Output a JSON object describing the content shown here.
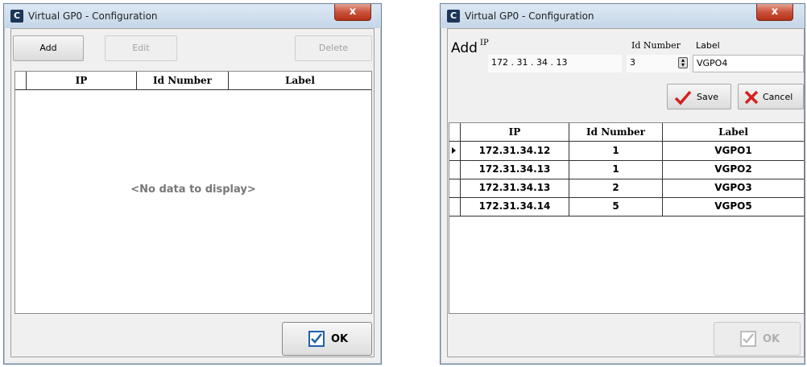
{
  "left_window": {
    "title": "Virtual GP0 - Configuration",
    "close_glyph": "x",
    "app_icon": "C",
    "toolbar": {
      "add": "Add",
      "edit": "Edit",
      "delete": "Delete"
    },
    "grid": {
      "columns": [
        "IP",
        "Id Number",
        "Label"
      ],
      "empty_text": "<No data to display>"
    },
    "ok_label": "OK"
  },
  "right_window": {
    "title": "Virtual GP0 - Configuration",
    "close_glyph": "x",
    "app_icon": "C",
    "form": {
      "heading": "Add",
      "ip_label": "IP",
      "ip_value": "172  .  31  .  34  .  13",
      "id_label": "Id Number",
      "id_value": "3",
      "label_label": "Label",
      "label_value": "VGPO4",
      "save": "Save",
      "cancel": "Cancel"
    },
    "grid": {
      "columns": [
        "IP",
        "Id Number",
        "Label"
      ],
      "rows": [
        {
          "ip": "172.31.34.12",
          "id": "1",
          "label": "VGPO1"
        },
        {
          "ip": "172.31.34.13",
          "id": "1",
          "label": "VGPO2"
        },
        {
          "ip": "172.31.34.13",
          "id": "2",
          "label": "VGPO3"
        },
        {
          "ip": "172.31.34.14",
          "id": "5",
          "label": "VGPO5"
        }
      ]
    },
    "ok_label": "OK"
  },
  "colors": {
    "accent_check": "#1f5fa8",
    "save_check": "#d42020",
    "cancel_x": "#d42020"
  }
}
